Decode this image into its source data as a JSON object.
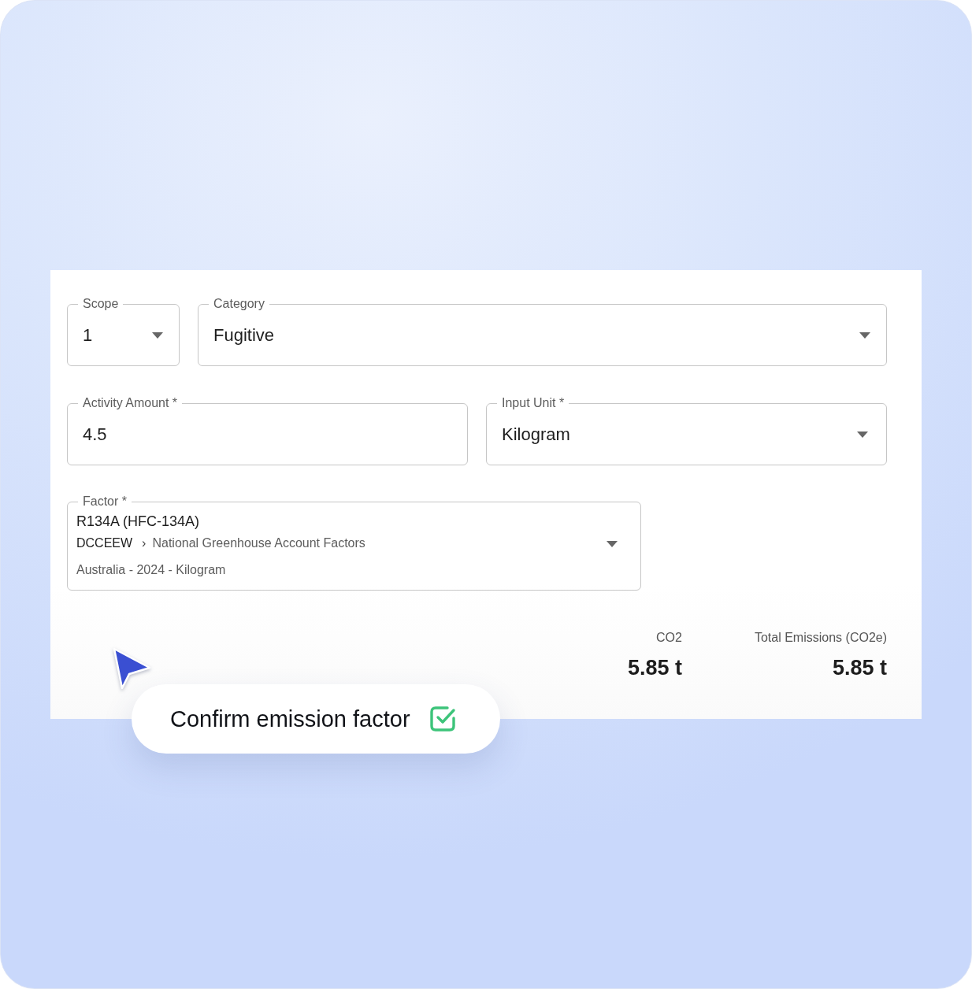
{
  "form": {
    "scope": {
      "label": "Scope",
      "value": "1"
    },
    "category": {
      "label": "Category",
      "value": "Fugitive"
    },
    "activity_amount": {
      "label": "Activity Amount *",
      "value": "4.5"
    },
    "input_unit": {
      "label": "Input Unit *",
      "value": "Kilogram"
    },
    "factor": {
      "label": "Factor *",
      "name": "R134A (HFC-134A)",
      "source": "DCCEEW",
      "separator": "›",
      "dataset": "National Greenhouse Account Factors",
      "details": "Australia - 2024 - Kilogram"
    }
  },
  "results": [
    {
      "label": "CO2",
      "value": "5.85 t"
    },
    {
      "label": "Total Emissions (CO2e)",
      "value": "5.85 t"
    }
  ],
  "confirm_callout": {
    "text": "Confirm emission factor",
    "checked": true
  }
}
